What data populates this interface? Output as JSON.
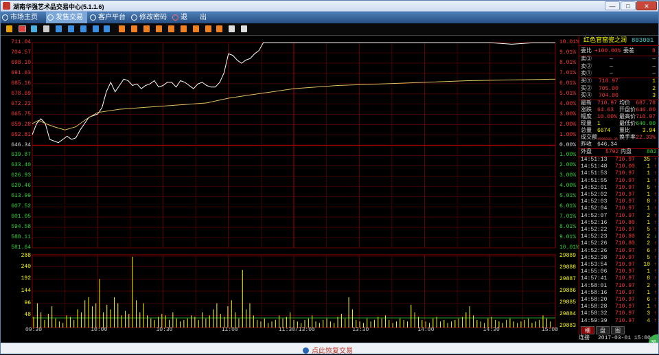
{
  "window": {
    "title": "湖南华强艺术品交易中心(5.1.1.6)"
  },
  "menu": {
    "items": [
      {
        "label": "市场主页",
        "active": false
      },
      {
        "label": "发售交易",
        "active": true
      },
      {
        "label": "客户平台",
        "active": false
      },
      {
        "label": "修改密码",
        "active": false
      },
      {
        "label": "退",
        "active": false
      },
      {
        "label": "出",
        "active": false
      }
    ]
  },
  "chart_data": {
    "type": "line",
    "title": "",
    "price_axis_left": [
      "711.04",
      "704.57",
      "698.10",
      "691.63",
      "685.16",
      "678.69",
      "672.22",
      "665.75",
      "659.28",
      "652.81",
      "646.34",
      "639.87",
      "633.40",
      "626.93",
      "620.46",
      "613.99",
      "607.52",
      "601.05",
      "594.58",
      "588.11",
      "581.64"
    ],
    "percent_axis_right": [
      "10.01%",
      "9.01%",
      "8.01%",
      "7.01%",
      "6.01%",
      "5.01%",
      "4.00%",
      "3.00%",
      "2.00%",
      "1.00%",
      "0.00%",
      "1.00%",
      "2.00%",
      "3.00%",
      "4.00%",
      "5.01%",
      "6.01%",
      "7.01%",
      "8.01%",
      "9.01%",
      "10.01%"
    ],
    "volume_axis_left": [
      "288",
      "240",
      "192",
      "144",
      "96",
      "48"
    ],
    "volume_axis_right": [
      "29889",
      "29888",
      "29887",
      "29886",
      "29885",
      "29884",
      "29883"
    ],
    "time_labels": [
      "09:30",
      "10:00",
      "10:30",
      "11:00",
      "11:30/13:00",
      "13:30",
      "14:00",
      "14:30",
      "15:00"
    ],
    "ylim": [
      581.64,
      711.04
    ],
    "reference_price": 646.34,
    "series": [
      {
        "color": "#ffffff",
        "x": [
          0,
          2,
          4,
          6,
          8,
          10,
          12,
          14,
          16,
          18,
          20,
          22,
          24,
          26,
          28,
          30,
          32,
          34,
          36,
          38,
          40,
          42,
          44,
          46,
          48,
          50,
          52,
          54,
          56,
          58,
          60,
          62,
          64,
          66,
          68,
          70,
          72,
          74,
          76,
          78,
          80,
          82,
          84,
          86,
          88,
          90,
          92,
          94,
          96,
          98,
          100,
          102,
          104,
          106,
          108,
          110,
          112,
          114,
          116,
          118,
          120,
          125,
          130,
          135,
          140,
          150,
          160,
          170,
          180,
          190,
          200,
          210,
          220,
          230,
          240
        ],
        "y": [
          653,
          660,
          663,
          660,
          650,
          649,
          648,
          650,
          652,
          650,
          651,
          656,
          660,
          664,
          665,
          666,
          670,
          680,
          686,
          680,
          684,
          688,
          687,
          684,
          685,
          682,
          684,
          685,
          687,
          683,
          684,
          686,
          686,
          683,
          687,
          686,
          684,
          682,
          685,
          686,
          684,
          683,
          683,
          686,
          692,
          704,
          703,
          700,
          698,
          700,
          701,
          704,
          706,
          711,
          711,
          711,
          711,
          711,
          711,
          711,
          711,
          711,
          711,
          711,
          711,
          711,
          711,
          711,
          711,
          711,
          711,
          711,
          710,
          710.97,
          710.97
        ]
      },
      {
        "color": "#e0c060",
        "x": [
          0,
          3,
          6,
          10,
          15,
          20,
          25,
          30,
          40,
          50,
          60,
          70,
          80,
          90,
          100,
          110,
          120,
          140,
          160,
          180,
          200,
          220,
          240
        ],
        "y": [
          660,
          662,
          660,
          658,
          656,
          658,
          663,
          667,
          669,
          670,
          671,
          672,
          673,
          676,
          678,
          680,
          682,
          684,
          685,
          686,
          687,
          687.5,
          688
        ]
      }
    ],
    "volume_bars": [
      42,
      96,
      60,
      30,
      54,
      84,
      36,
      24,
      18,
      48,
      42,
      30,
      72,
      60,
      108,
      120,
      84,
      96,
      192,
      60,
      90,
      72,
      120,
      96,
      48,
      66,
      54,
      280,
      108,
      60,
      96,
      48,
      36,
      30,
      42,
      54,
      48,
      30,
      60,
      36,
      24,
      30,
      36,
      48,
      42,
      30,
      60,
      36,
      48,
      72,
      96,
      54,
      42,
      84,
      108,
      60,
      36,
      228,
      72,
      96,
      48,
      30,
      24,
      36,
      18,
      24,
      30,
      48,
      36,
      42,
      60,
      30,
      24,
      18,
      30,
      36,
      48,
      24,
      18,
      30,
      36,
      24,
      18,
      42,
      54,
      36,
      120,
      72,
      30,
      24,
      18,
      36,
      24,
      30,
      42,
      36,
      48,
      30,
      18,
      24,
      36,
      30,
      24,
      90,
      60,
      42,
      30,
      24,
      18,
      36,
      42,
      24,
      30,
      18,
      24,
      30,
      36,
      42,
      60,
      84,
      48,
      30,
      24,
      18,
      36,
      42,
      30,
      24,
      18,
      30,
      36,
      24,
      18,
      24,
      30,
      36,
      18,
      24,
      30,
      48,
      36,
      24
    ]
  },
  "panel": {
    "title": "红色官窑瓷之润",
    "code": "803001",
    "webi_label": "委比",
    "webi_value": "+100.00%",
    "wecha_label": "委差",
    "wecha_value": "8",
    "asks": [
      {
        "label": "卖③",
        "price": "—",
        "vol": "—"
      },
      {
        "label": "卖②",
        "price": "—",
        "vol": "—"
      },
      {
        "label": "卖①",
        "price": "—",
        "vol": "—"
      }
    ],
    "bids": [
      {
        "label": "买①",
        "price": "710.97",
        "vol": "1"
      },
      {
        "label": "买②",
        "price": "705.00",
        "vol": "2"
      },
      {
        "label": "买③",
        "price": "704.00",
        "vol": "3"
      }
    ],
    "stats": [
      {
        "l1": "最新",
        "v1": "710.97",
        "l2": "均价",
        "v2": "687.78"
      },
      {
        "l1": "涨跌",
        "v1": "64.63",
        "l2": "开盘价",
        "v2": "646.00"
      },
      {
        "l1": "幅度",
        "v1": "10.00%",
        "l2": "最高价",
        "v2": "710.97"
      },
      {
        "l1": "现量",
        "v1": "1",
        "l2": "最低价",
        "v2": "640.00"
      },
      {
        "l1": "总量",
        "v1": "6674",
        "l2": "量比",
        "v2": "3.94"
      },
      {
        "l1": "成交额",
        "v1": "4586836.35",
        "l2": "换手率",
        "v2": "22.33%"
      },
      {
        "l1": "昨收",
        "v1": "646.34",
        "l2": "",
        "v2": ""
      }
    ],
    "outer_label": "外盘",
    "outer_value": "5792",
    "inner_label": "内盘",
    "inner_value": "882",
    "ticks": [
      {
        "time": "14:51:13",
        "price": "710.97",
        "vol": "35",
        "dir": "↑"
      },
      {
        "time": "14:51:48",
        "price": "710.00",
        "vol": "1",
        "dir": "↑"
      },
      {
        "time": "14:51:53",
        "price": "710.97",
        "vol": "1",
        "dir": "↑"
      },
      {
        "time": "14:51:55",
        "price": "710.97",
        "vol": "1",
        "dir": "↑"
      },
      {
        "time": "14:52:01",
        "price": "710.97",
        "vol": "5",
        "dir": "↑"
      },
      {
        "time": "14:52:02",
        "price": "710.97",
        "vol": "1",
        "dir": "↑"
      },
      {
        "time": "14:52:03",
        "price": "710.97",
        "vol": "8",
        "dir": "↑"
      },
      {
        "time": "14:52:04",
        "price": "710.97",
        "vol": "1",
        "dir": "↑"
      },
      {
        "time": "14:52:07",
        "price": "710.97",
        "vol": "2",
        "dir": "↑"
      },
      {
        "time": "14:52:16",
        "price": "710.80",
        "vol": "1",
        "dir": "↑"
      },
      {
        "time": "14:52:22",
        "price": "710.97",
        "vol": "5",
        "dir": "↑"
      },
      {
        "time": "14:52:23",
        "price": "710.80",
        "vol": "2",
        "dir": "↓"
      },
      {
        "time": "14:52:26",
        "price": "710.80",
        "vol": "2",
        "dir": "↑"
      },
      {
        "time": "14:52:26",
        "price": "710.97",
        "vol": "6",
        "dir": "↑"
      },
      {
        "time": "14:52:38",
        "price": "710.97",
        "vol": "5",
        "dir": "↑"
      },
      {
        "time": "14:53:54",
        "price": "710.97",
        "vol": "10",
        "dir": "↑"
      },
      {
        "time": "14:55:06",
        "price": "710.97",
        "vol": "1",
        "dir": "↑"
      },
      {
        "time": "14:57:41",
        "price": "710.97",
        "vol": "8",
        "dir": "↑"
      },
      {
        "time": "14:58:01",
        "price": "710.97",
        "vol": "2",
        "dir": "↑"
      },
      {
        "time": "14:58:16",
        "price": "710.97",
        "vol": "1",
        "dir": "↑"
      },
      {
        "time": "14:58:20",
        "price": "710.97",
        "vol": "6",
        "dir": "↑"
      },
      {
        "time": "14:58:28",
        "price": "710.97",
        "vol": "1",
        "dir": "↑"
      },
      {
        "time": "14:58:32",
        "price": "710.97",
        "vol": "3",
        "dir": "↑"
      },
      {
        "time": "14:59:39",
        "price": "710.97",
        "vol": "4",
        "dir": "↑"
      }
    ],
    "tabs": [
      "细",
      "盘",
      "图"
    ],
    "status_left": "连接",
    "status_datetime": "2017-03-01 15:00"
  },
  "bottom": {
    "restore_label": "点此恢复交易"
  },
  "colors": {
    "up": "#ff3c3c",
    "down": "#35d535",
    "grid": "#8a0000",
    "price_line": "#ffffff",
    "avg_line": "#e0c060",
    "cyan": "#3fd0d0",
    "yellow": "#ffff00"
  },
  "toolbar_icons": [
    "bar-chart-icon",
    "line-chart-icon",
    "candle-icon",
    "table-icon",
    "f1-icon",
    "f2-icon",
    "f3-icon",
    "f4-icon",
    "f5-icon",
    "g1-icon",
    "g2-icon",
    "g3-icon",
    "g4-icon",
    "g5-icon",
    "g6-icon",
    "g7-icon",
    "g8-icon",
    "g9-icon",
    "edit-icon",
    "settings-icon"
  ]
}
